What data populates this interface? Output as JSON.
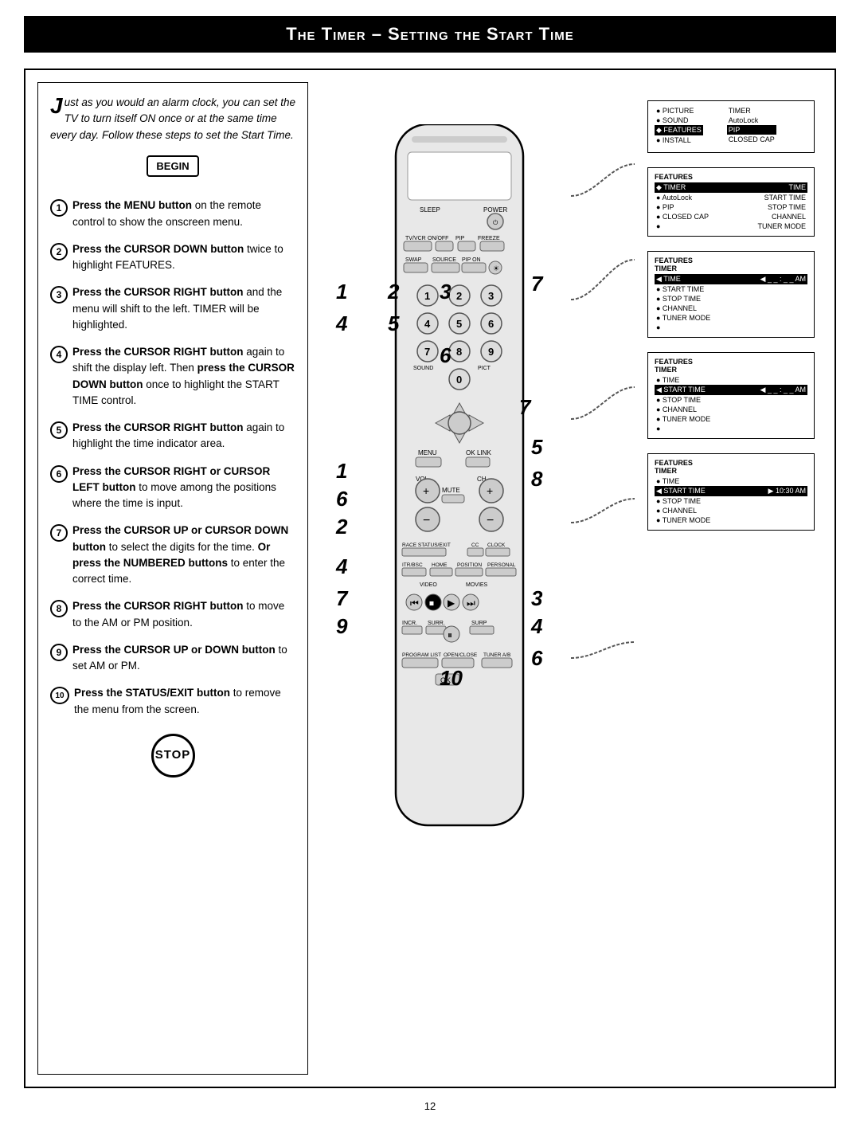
{
  "page": {
    "title": "The Timer – Setting the Start Time",
    "page_number": "12"
  },
  "intro": {
    "text": "ust as you would an alarm clock, you can set the TV to turn itself ON once or at the same time every day. Follow these steps to set the Start Time.",
    "first_letter": "J"
  },
  "begin_label": "BEGIN",
  "stop_label": "STOP",
  "steps": [
    {
      "num": "1",
      "text": "Press the MENU button on the remote control to show the onscreen menu."
    },
    {
      "num": "2",
      "text": "Press the CURSOR DOWN button twice to highlight FEATURES."
    },
    {
      "num": "3",
      "text": "Press the CURSOR RIGHT button and the menu will shift to the left. TIMER will be highlighted."
    },
    {
      "num": "4",
      "text": "Press the CURSOR RIGHT button again to shift the display left. Then press the CURSOR DOWN button once to highlight the START TIME control."
    },
    {
      "num": "5",
      "text": "Press the CURSOR RIGHT button again to highlight the time indicator area."
    },
    {
      "num": "6",
      "text": "Press the CURSOR RIGHT or CURSOR LEFT button to move among the positions where the time is input."
    },
    {
      "num": "7",
      "text": "Press the CURSOR UP or CURSOR DOWN button to select the digits for the time. Or press the NUMBERED buttons to enter the correct time."
    },
    {
      "num": "8",
      "text": "Press the CURSOR RIGHT button to move to the AM or PM position."
    },
    {
      "num": "9",
      "text": "Press the CURSOR UP or DOWN button to set AM or PM."
    },
    {
      "num": "10",
      "text": "Press the STATUS/EXIT button to remove the menu from the screen."
    }
  ],
  "screens": [
    {
      "id": "screen1",
      "title": "",
      "rows": [
        {
          "label": "● PICTURE",
          "val": "TIMER",
          "highlighted": false
        },
        {
          "label": "● SOUND",
          "val": "AutoLock",
          "highlighted": false
        },
        {
          "label": "◆ FEATURES",
          "val": "PIP",
          "highlighted": true
        },
        {
          "label": "● INSTALL",
          "val": "CLOSED CAP",
          "highlighted": false
        }
      ]
    },
    {
      "id": "screen2",
      "title": "FEATURES",
      "rows": [
        {
          "label": "◆ TIMER",
          "val": "TIME",
          "highlighted": true
        },
        {
          "label": "● AutoLock",
          "val": "START TIME",
          "highlighted": false
        },
        {
          "label": "● PIP",
          "val": "STOP TIME",
          "highlighted": false
        },
        {
          "label": "● CLOSED CAP",
          "val": "CHANNEL",
          "highlighted": false
        },
        {
          "label": "●",
          "val": "TUNER MODE",
          "highlighted": false
        }
      ]
    },
    {
      "id": "screen3",
      "title": "FEATURES",
      "subtitle": "TIMER",
      "rows": [
        {
          "label": "◀ TIME",
          "val": "◀ _ _ : _ _ AM",
          "highlighted": true
        },
        {
          "label": "● START TIME",
          "val": "",
          "highlighted": false
        },
        {
          "label": "● STOP TIME",
          "val": "",
          "highlighted": false
        },
        {
          "label": "● CHANNEL",
          "val": "",
          "highlighted": false
        },
        {
          "label": "● TUNER MODE",
          "val": "",
          "highlighted": false
        },
        {
          "label": "●",
          "val": "",
          "highlighted": false
        }
      ]
    },
    {
      "id": "screen4",
      "title": "FEATURES",
      "subtitle": "TIMER",
      "rows": [
        {
          "label": "● TIME",
          "val": "",
          "highlighted": false
        },
        {
          "label": "◀ START TIME",
          "val": "◀ _ _ : _ _ AM",
          "highlighted": true
        },
        {
          "label": "● STOP TIME",
          "val": "",
          "highlighted": false
        },
        {
          "label": "● CHANNEL",
          "val": "",
          "highlighted": false
        },
        {
          "label": "● TUNER MODE",
          "val": "",
          "highlighted": false
        },
        {
          "label": "●",
          "val": "",
          "highlighted": false
        }
      ]
    },
    {
      "id": "screen5",
      "title": "FEATURES",
      "subtitle": "TIMER",
      "rows": [
        {
          "label": "● TIME",
          "val": "",
          "highlighted": false
        },
        {
          "label": "◀ START TIME",
          "val": "▶ 10:30 AM",
          "highlighted": true
        },
        {
          "label": "● STOP TIME",
          "val": "",
          "highlighted": false
        },
        {
          "label": "● CHANNEL",
          "val": "",
          "highlighted": false
        },
        {
          "label": "● TUNER MODE",
          "val": "",
          "highlighted": false
        }
      ]
    }
  ],
  "remote_numbers": [
    "1",
    "2",
    "3",
    "4",
    "5",
    "6",
    "7",
    "8",
    "9",
    "10"
  ],
  "step_positions": {
    "note": "Step numbers 1-10 positioned on remote"
  }
}
